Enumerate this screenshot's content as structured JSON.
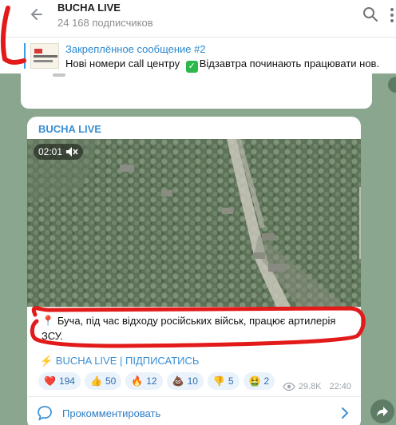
{
  "header": {
    "title": "BUCHA LIVE",
    "subscribers": "24 168 подписчиков",
    "back_icon": "arrow-left-icon",
    "search_icon": "search-icon",
    "menu_icon": "more-vert-icon"
  },
  "pinned": {
    "title": "Закреплённое сообщение #2",
    "text_before": "Нові номери call центру",
    "text_after": "Відзавтра починають працювати нов."
  },
  "message": {
    "channel": "BUCHA LIVE",
    "video_duration": "02:01",
    "caption": "Буча, під час відходу російських військ, працює артилерія ЗСУ.",
    "signature": "⚡ BUCHA LIVE | ПІДПИСАТИСЬ",
    "reactions": [
      {
        "emoji": "❤️",
        "count": "194"
      },
      {
        "emoji": "👍",
        "count": "50"
      },
      {
        "emoji": "🔥",
        "count": "12"
      },
      {
        "emoji": "💩",
        "count": "10"
      },
      {
        "emoji": "👎",
        "count": "5"
      },
      {
        "emoji": "🤮",
        "count": "2"
      }
    ],
    "views": "29.8K",
    "time": "22:40",
    "comments_label": "Прокомментировать"
  },
  "colors": {
    "accent": "#3a8fd3",
    "annotation": "#e21a1a",
    "background": "#8aa68e"
  }
}
